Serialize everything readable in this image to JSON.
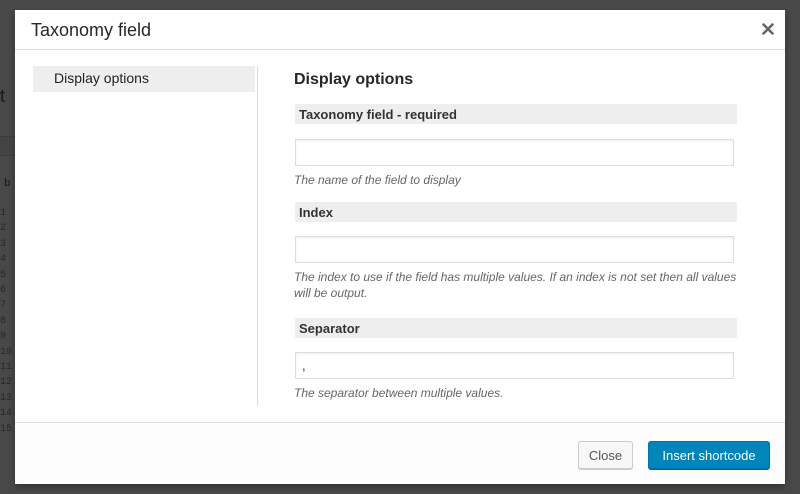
{
  "background": {
    "letter": "t",
    "column_letter": "b",
    "line_numbers": [
      "1",
      "2",
      "3",
      "4",
      "5",
      "6",
      "7",
      "8",
      "9",
      "10",
      "11",
      "12",
      "13",
      "14",
      "15"
    ]
  },
  "modal": {
    "title": "Taxonomy field",
    "sidebar": {
      "items": [
        {
          "label": "Display options",
          "active": true
        }
      ]
    },
    "content": {
      "title": "Display options",
      "fields": [
        {
          "label": "Taxonomy field - required",
          "value": "",
          "help": "The name of the field to display"
        },
        {
          "label": "Index",
          "value": "",
          "help": "The index to use if the field has multiple values. If an index is not set then all values will be output."
        },
        {
          "label": "Separator",
          "value": ",",
          "help": "The separator between multiple values."
        }
      ]
    },
    "footer": {
      "close_label": "Close",
      "insert_label": "Insert shortcode"
    }
  },
  "colors": {
    "primary": "#0085ba",
    "overlay": "#000000"
  },
  "icons": {
    "close": "close-icon"
  }
}
